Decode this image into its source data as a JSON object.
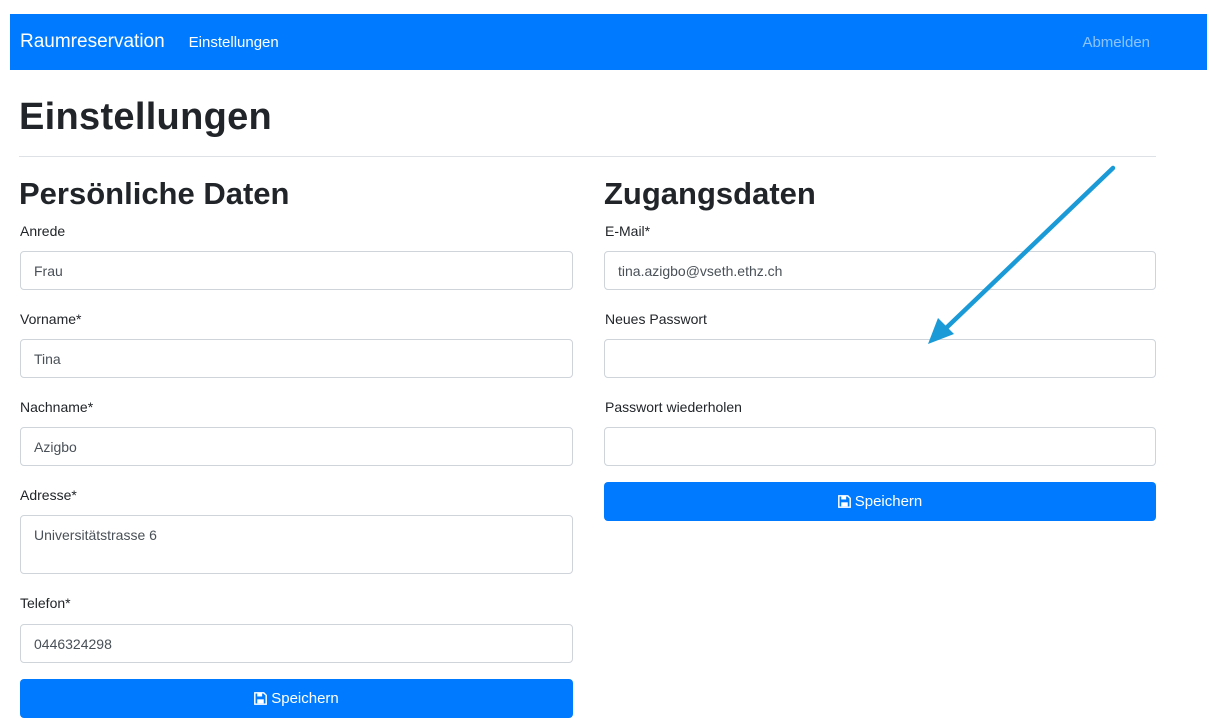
{
  "navbar": {
    "brand": "Raumreservation",
    "link": "Einstellungen",
    "logout": "Abmelden"
  },
  "page": {
    "title": "Einstellungen"
  },
  "personal": {
    "title": "Persönliche Daten",
    "salutation": {
      "label": "Anrede",
      "value": "Frau"
    },
    "firstname": {
      "label": "Vorname*",
      "value": "Tina"
    },
    "lastname": {
      "label": "Nachname*",
      "value": "Azigbo"
    },
    "address": {
      "label": "Adresse*",
      "value": "Universitätstrasse 6"
    },
    "phone": {
      "label": "Telefon*",
      "value": "0446324298"
    },
    "save_label": "Speichern"
  },
  "access": {
    "title": "Zugangsdaten",
    "email": {
      "label": "E-Mail*",
      "value": "tina.azigbo@vseth.ethz.ch"
    },
    "new_password": {
      "label": "Neues Passwort",
      "value": ""
    },
    "repeat_password": {
      "label": "Passwort wiederholen",
      "value": ""
    },
    "save_label": "Speichern"
  },
  "colors": {
    "primary": "#007bff",
    "annotation_arrow": "#1a9ad6"
  },
  "icons": {
    "save": "floppy-disk-icon",
    "annotation": "arrow-icon"
  }
}
